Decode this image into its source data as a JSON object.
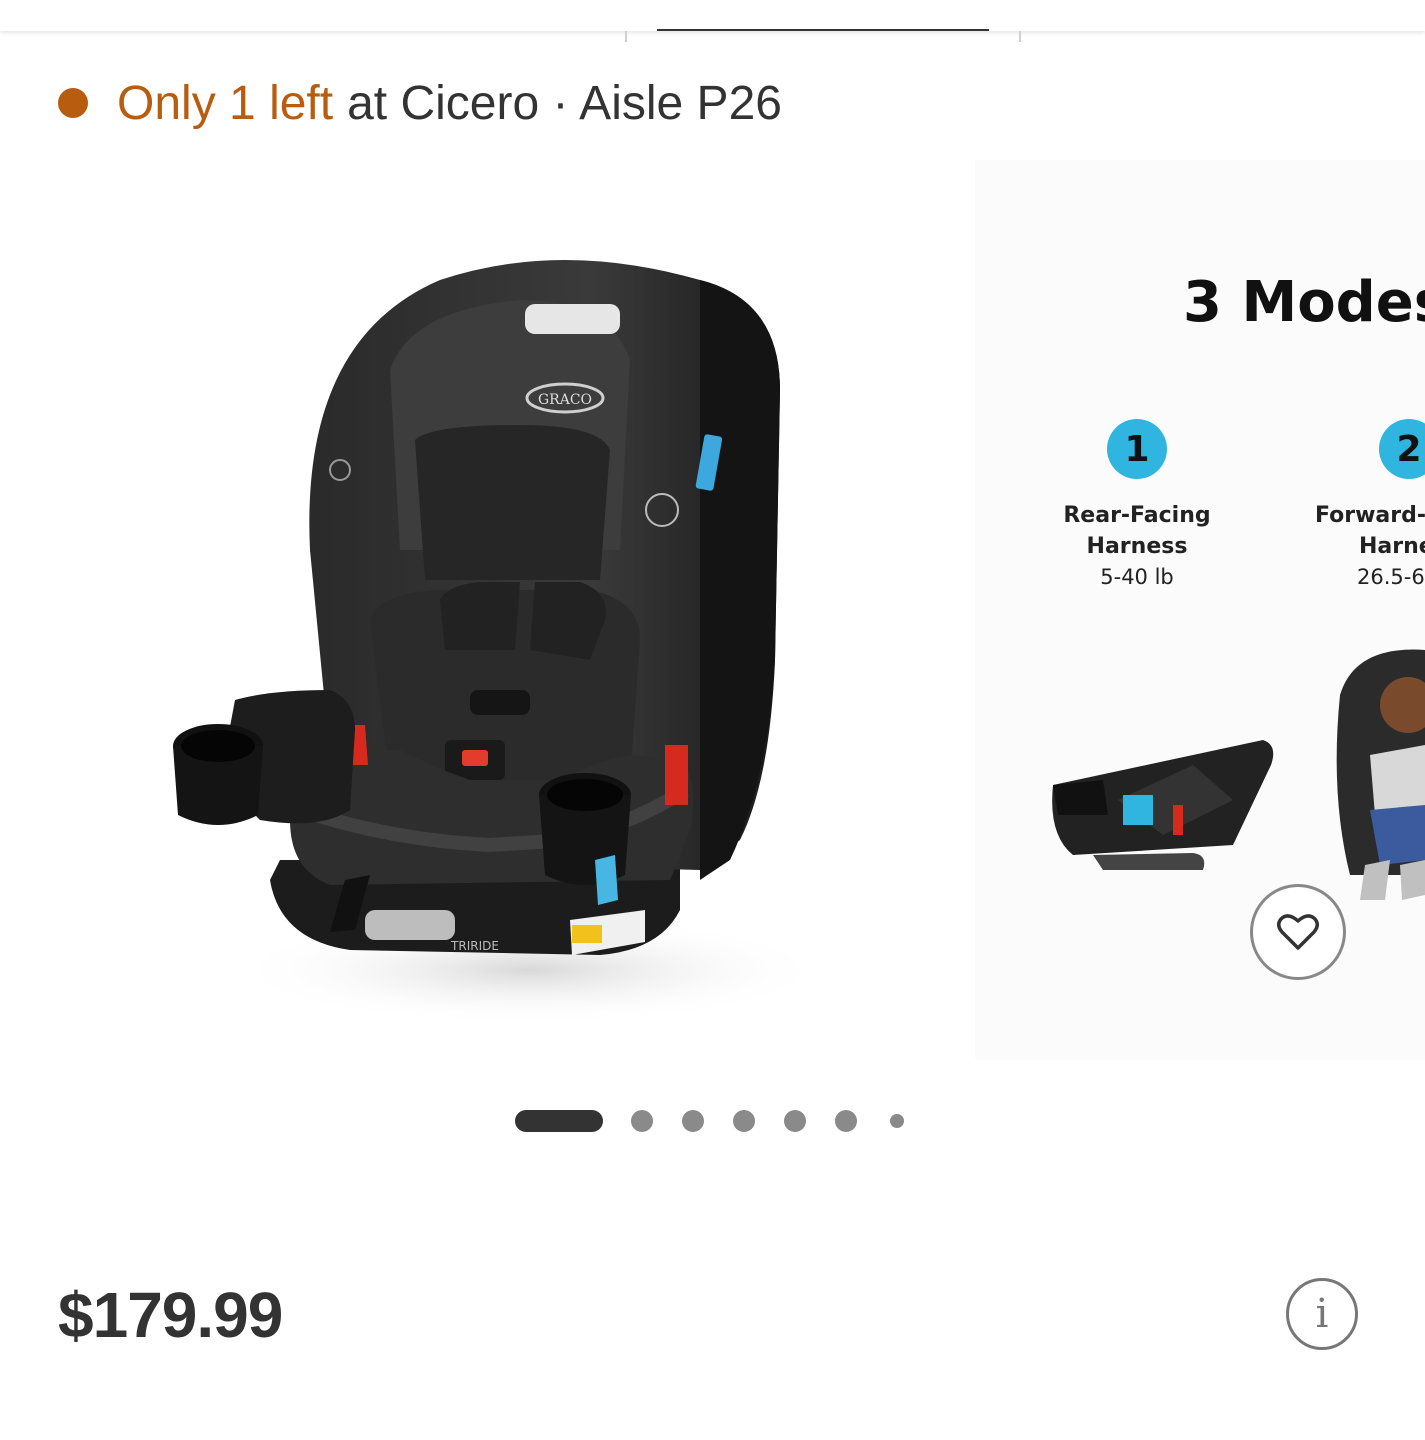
{
  "stock": {
    "highlight": "Only 1 left",
    "rest": "at Cicero · Aisle P26",
    "status_color": "#b85c0f"
  },
  "carousel": {
    "product_image": {
      "brand_text": "GRACO",
      "model_text": "TRIRIDE",
      "icon": "car-seat-image"
    },
    "modes_slide": {
      "title": "3 Modes",
      "badge_color": "#2fb5e0",
      "modes": [
        {
          "number": "1",
          "label_line1": "Rear-Facing",
          "label_line2": "Harness",
          "weight": "5-40 lb"
        },
        {
          "number": "2",
          "label_line1": "Forward-",
          "label_line2": "Harne",
          "weight": "26.5-6"
        }
      ]
    },
    "page_count": 7,
    "current_page": 1
  },
  "favorite": {
    "icon": "heart-icon"
  },
  "price": {
    "value": "$179.99"
  },
  "info": {
    "icon": "info-icon",
    "glyph": "i"
  }
}
